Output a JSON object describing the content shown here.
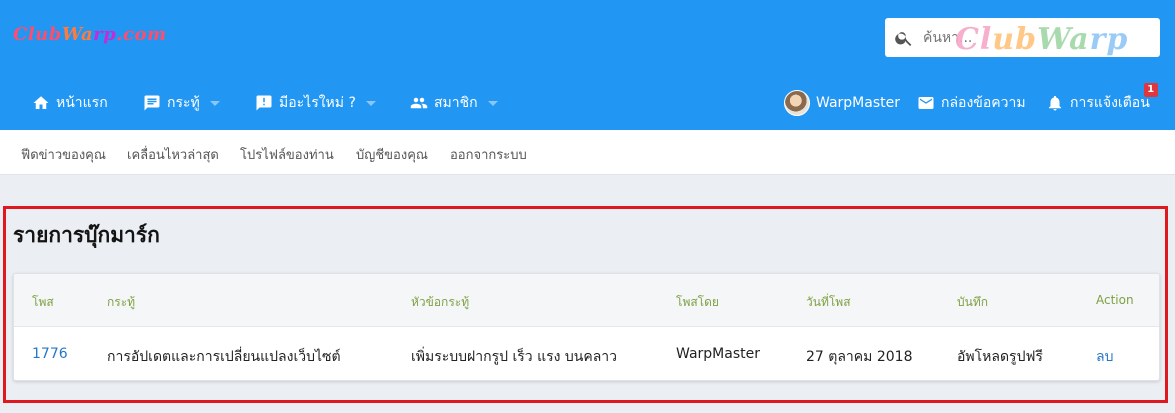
{
  "brand": {
    "logo_parts": [
      "Club",
      "Wa",
      "rp",
      ".com"
    ],
    "watermark_parts": [
      "Cl",
      "ub",
      "Wa",
      "rp"
    ]
  },
  "search": {
    "placeholder": "ค้นหา..."
  },
  "nav": {
    "items": [
      {
        "label": "หน้าแรก",
        "icon": "home-icon"
      },
      {
        "label": "กระทู้",
        "icon": "forum-icon",
        "has_dropdown": true
      },
      {
        "label": "มีอะไรใหม่ ?",
        "icon": "whats-new-icon",
        "has_dropdown": true
      },
      {
        "label": "สมาชิก",
        "icon": "members-icon",
        "has_dropdown": true
      }
    ],
    "user": {
      "name": "WarpMaster"
    },
    "inbox": {
      "label": "กล่องข้อความ",
      "icon": "envelope-icon"
    },
    "alerts": {
      "label": "การแจ้งเตือน",
      "icon": "bell-icon",
      "count": "1"
    }
  },
  "subnav": {
    "items": [
      "ฟีดข่าวของคุณ",
      "เคลื่อนไหวล่าสุด",
      "โปรไฟล์ของท่าน",
      "บัญชีของคุณ",
      "ออกจากระบบ"
    ]
  },
  "page": {
    "title": "รายการบุ๊กมาร์ก"
  },
  "table": {
    "columns": [
      "โพส",
      "กระทู้",
      "หัวข้อกระทู้",
      "โพสโดย",
      "วันที่โพส",
      "บันทึก",
      "Action"
    ],
    "rows": [
      [
        "1776",
        "การอัปเดตและการเปลี่ยนแปลงเว็บไซต์",
        "เพิ่มระบบฝากรูป เร็ว แรง บนคลาว",
        "WarpMaster",
        "27 ตุลาคม 2018",
        "อัพโหลดรูปฟรี",
        "ลบ"
      ]
    ]
  },
  "colors": {
    "header": "#2196f3",
    "highlight_border": "#e0191f",
    "link": "#2577c8",
    "column_header": "#7fa043",
    "badge": "#e0373f"
  }
}
